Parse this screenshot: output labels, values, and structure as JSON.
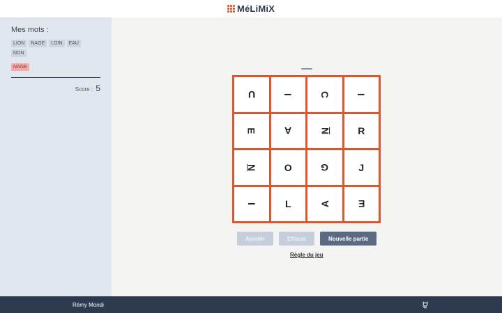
{
  "app": {
    "title": "MéLiMiX",
    "logo_icon": "grid-icon"
  },
  "sidebar": {
    "title": "Mes mots :",
    "words": [
      "LION",
      "NAGE",
      "LOIN",
      "EAU",
      "NON"
    ],
    "current_words": [
      "NAGE"
    ],
    "score_label": "Score :",
    "score": "5"
  },
  "board": {
    "current_word": "",
    "rows": [
      [
        "U",
        "I",
        "C",
        "I"
      ],
      [
        "E",
        "A",
        "N",
        "R"
      ],
      [
        "N",
        "O",
        "G",
        "J"
      ],
      [
        "I",
        "L",
        "A",
        "E"
      ]
    ],
    "rotations": [
      [
        180,
        90,
        90,
        90
      ],
      [
        90,
        180,
        270,
        0
      ],
      [
        90,
        0,
        180,
        0
      ],
      [
        90,
        0,
        270,
        180
      ]
    ],
    "underlined": [
      [
        false,
        false,
        false,
        false
      ],
      [
        false,
        false,
        true,
        false
      ],
      [
        true,
        false,
        false,
        false
      ],
      [
        false,
        false,
        false,
        false
      ]
    ],
    "frame_color": "#e0562a"
  },
  "actions": {
    "add_label": "Ajouter",
    "clear_label": "Effacer",
    "new_game_label": "Nouvelle partie",
    "rules_label": "Règle du jeu"
  },
  "footer": {
    "author": "Rémy Mondi",
    "icon": "github-icon"
  }
}
